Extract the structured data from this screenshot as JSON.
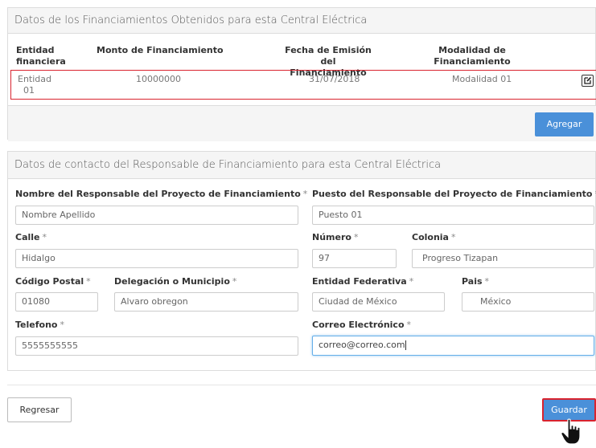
{
  "financing": {
    "title": "Datos de los Financiamientos Obtenidos para esta Central Eléctrica",
    "columns": {
      "entity": [
        "Entidad",
        "financiera"
      ],
      "amount": "Monto de Financiamiento",
      "date": [
        "Fecha de Emisión del",
        "Financiamiento"
      ],
      "modality": [
        "Modalidad de",
        "Financiamiento"
      ]
    },
    "row": {
      "entity": [
        "Entidad",
        "01"
      ],
      "amount": "10000000",
      "date": "31/07/2018",
      "modality": "Modalidad 01"
    },
    "add_label": "Agregar"
  },
  "contact": {
    "title": "Datos de contacto del Responsable de Financiamiento para esta Central Eléctrica",
    "required_mark": "*",
    "fields": {
      "name": {
        "label": "Nombre del Responsable del Proyecto de Financiamiento",
        "value": "Nombre Apellido"
      },
      "position": {
        "label": "Puesto del Responsable del Proyecto de Financiamiento",
        "value": "Puesto 01"
      },
      "street": {
        "label": "Calle",
        "value": "Hidalgo"
      },
      "number": {
        "label": "Número",
        "value": "97"
      },
      "colony": {
        "label": "Colonia",
        "value": "Progreso Tizapan"
      },
      "zip": {
        "label": "Código Postal",
        "value": "01080"
      },
      "municipality": {
        "label": "Delegación o Municipio",
        "value": "Alvaro obregon"
      },
      "state": {
        "label": "Entidad Federativa",
        "value": "Ciudad de México"
      },
      "country": {
        "label": "Pais",
        "value": "México"
      },
      "phone": {
        "label": "Telefono",
        "value": "5555555555"
      },
      "email": {
        "label": "Correo Electrónico",
        "value": "correo@correo.com"
      }
    }
  },
  "footer": {
    "back_label": "Regresar",
    "save_label": "Guardar"
  },
  "colors": {
    "primary": "#4a90d9",
    "highlight_border": "#d9232e"
  }
}
